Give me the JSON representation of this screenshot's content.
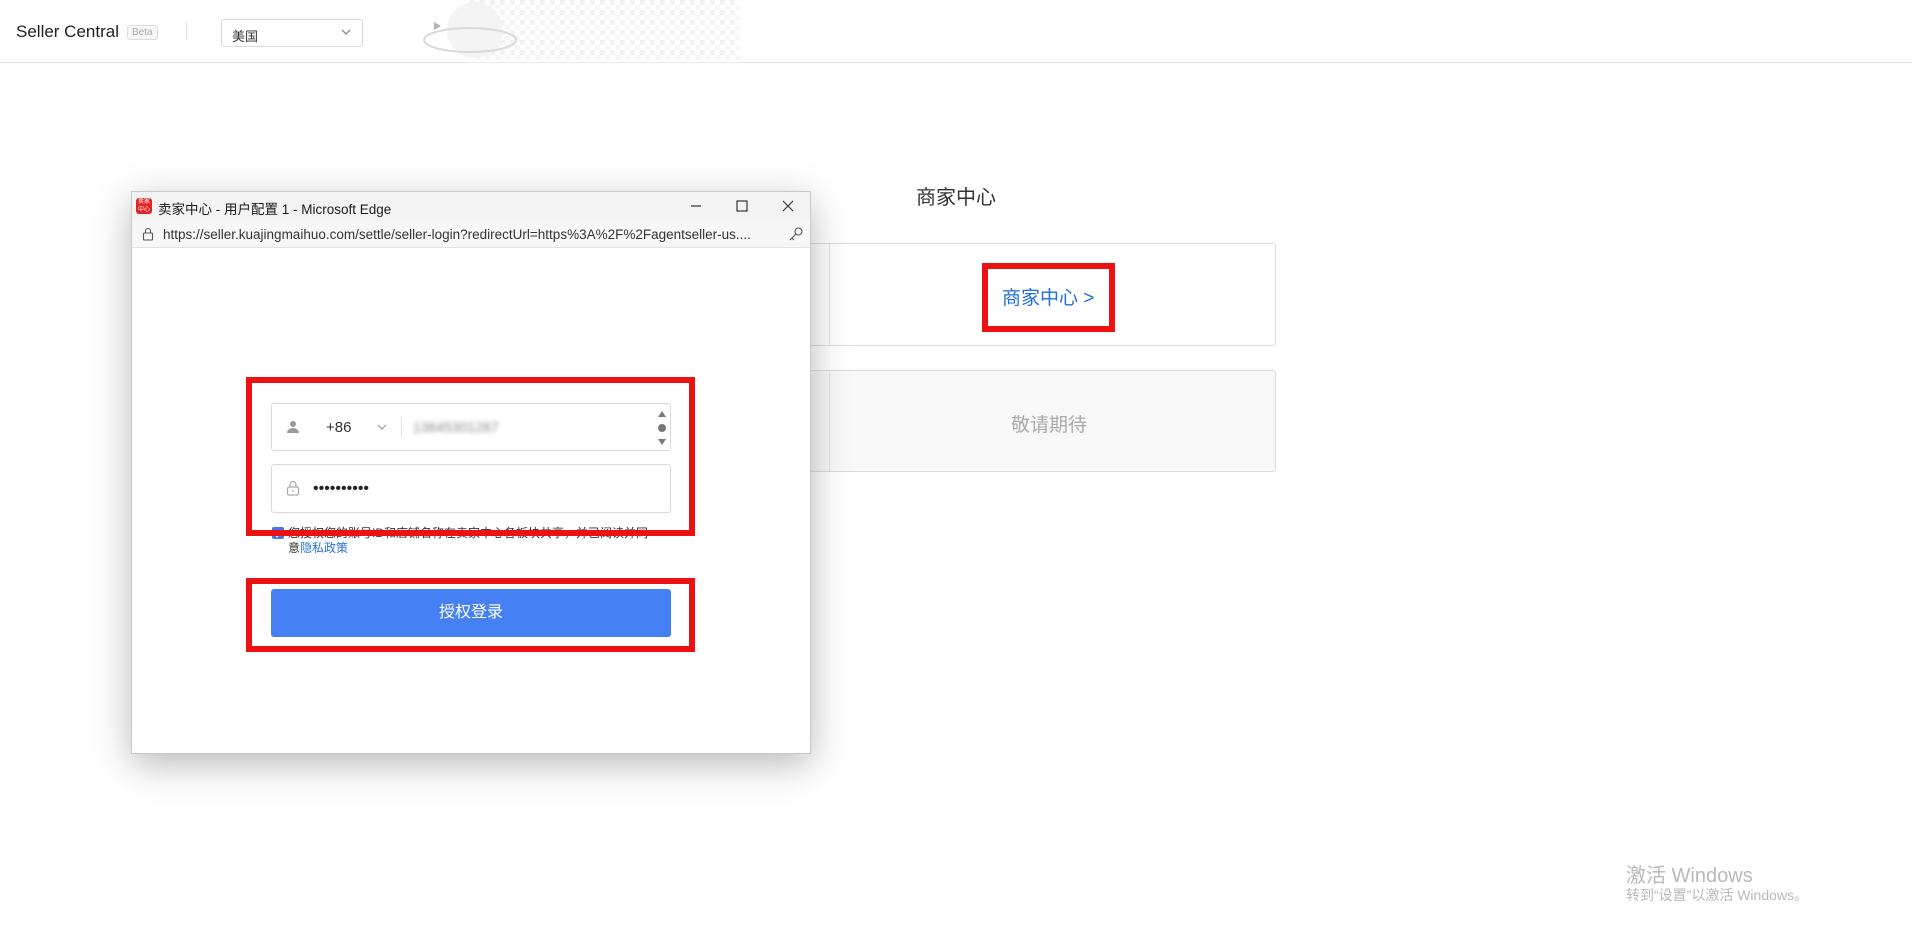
{
  "header": {
    "brand": "Seller Central",
    "beta": "Beta",
    "region": "美国"
  },
  "main": {
    "title": "商家中心",
    "merchant_link": "商家中心 >",
    "coming_soon": "敬请期待"
  },
  "popup": {
    "window_title": "卖家中心 - 用户配置 1 - Microsoft Edge",
    "app_icon_text": "卖家中心",
    "url": "https://seller.kuajingmaihuo.com/settle/seller-login?redirectUrl=https%3A%2F%2Fagentseller-us....",
    "country_code": "+86",
    "phone_value": "13645301287",
    "password_mask": "••••••••••",
    "consent_text": "您授权您的账号ID和店铺名称在卖家中心各板块共享，并已阅读并同意",
    "privacy_link": "隐私政策",
    "submit_label": "授权登录"
  },
  "watermark": {
    "line1": "激活 Windows",
    "line2": "转到“设置”以激活 Windows。"
  },
  "colors": {
    "accent": "#4580f5",
    "link": "#1e6fd9",
    "highlight": "#ee1111"
  }
}
